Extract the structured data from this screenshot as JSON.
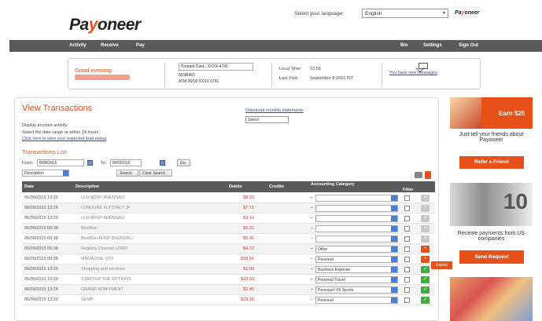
{
  "header": {
    "logo_main": "Pa",
    "logo_o": "y",
    "logo_rest": "oneer",
    "language_label": "Select your language:",
    "language_value": "English",
    "mini_logo_a": "Pa",
    "mini_logo_o": "y",
    "mini_logo_b": "oneer"
  },
  "nav": {
    "items": [
      "Activity",
      "Receive",
      "Pay"
    ],
    "right_items": [
      "Bio",
      "Settings",
      "Sign Out"
    ]
  },
  "account": {
    "greeting": "Good evening",
    "card_select": "Prepaid Card - XXXX-4741",
    "card_number": "5598401",
    "card_sub": "ATM 06/18 XXXX 6741",
    "local_time_label": "Local Time:",
    "local_time_value": "13:58",
    "last_visit_label": "Last Visit:",
    "last_visit_value": "September 8 2015 IST",
    "messages": "You have new messages"
  },
  "main": {
    "title": "View Transactions",
    "line1": "Display account activity:",
    "line2": "Select the date range or within 24 hours",
    "link": "Click here to view your expected load status",
    "download_label": "Download monthly statements",
    "download_value": "Select",
    "list_title": "Transactions List",
    "from_label": "From:",
    "from_value": "8/08/2015",
    "to_label": "To:",
    "to_value": "8/09/2015",
    "go_label": "Go",
    "desc_select": "Description",
    "search_btn": "Search",
    "clear_btn": "Clear Search"
  },
  "table": {
    "headers": [
      "Date",
      "Description",
      "Debits",
      "Credits",
      "Accounting Category",
      "Filter"
    ],
    "rows": [
      {
        "date": "06/09/2015 13:29",
        "desc": "LUV ADSP BHENSALI",
        "debit": "$8.50",
        "cat": "",
        "action": "grey",
        "alt": false
      },
      {
        "date": "06/09/2015 13:29",
        "desc": "LONDONE FLYSTALY JF",
        "debit": "$7.71",
        "cat": "",
        "action": "grey",
        "alt": true
      },
      {
        "date": "06/09/2015 13:29",
        "desc": "LUV ADSP BHENSALI",
        "debit": "$3.14",
        "cat": "",
        "action": "grey",
        "alt": false
      },
      {
        "date": "06/09/2015 09:38",
        "desc": "BestRun",
        "debit": "$2.21",
        "cat": "",
        "action": "grey",
        "alt": true
      },
      {
        "date": "06/09/2015 09:38",
        "desc": "BestRun ADSP BHENSALI",
        "debit": "$5.45",
        "cat": "",
        "action": "grey",
        "alt": false
      },
      {
        "date": "06/09/2015 09:38",
        "desc": "Registry Channel LORD",
        "debit": "$4.72",
        "cat": "Other",
        "action": "orange",
        "alt": true
      },
      {
        "date": "06/09/2015 09:38",
        "desc": "MAGAZINE STD",
        "debit": "$38.56",
        "cat": "Personal",
        "action": "orange",
        "alt": false
      },
      {
        "date": "06/09/2015 13:29",
        "desc": "Shopping and services",
        "debit": "$1.99",
        "cat": "Business Expense",
        "action": "green",
        "alt": true
      },
      {
        "date": "06/09/2015 13:29",
        "desc": "STARTUP THE OPTIONS",
        "debit": "$33.50",
        "cat": "Personal Travel",
        "action": "green",
        "alt": false
      },
      {
        "date": "06/09/2015 13:29",
        "desc": "GRAND ADMITMENT",
        "debit": "$2.45",
        "cat": "Personal / Fit Sports",
        "action": "green",
        "alt": true
      },
      {
        "date": "06/09/2015 13:29",
        "desc": "SEMP",
        "debit": "$29.18",
        "cat": "Personal",
        "action": "green",
        "alt": false
      }
    ],
    "export_tip": "Export"
  },
  "sidebar": {
    "ad1_earn": "Earn $25",
    "ad1_text": "Just tell your friends about Payoneer",
    "ad1_btn": "Refer a Friend",
    "ad2_amount": "10",
    "ad2_text": "Receive payments from US companies",
    "ad2_btn": "Send Request"
  }
}
